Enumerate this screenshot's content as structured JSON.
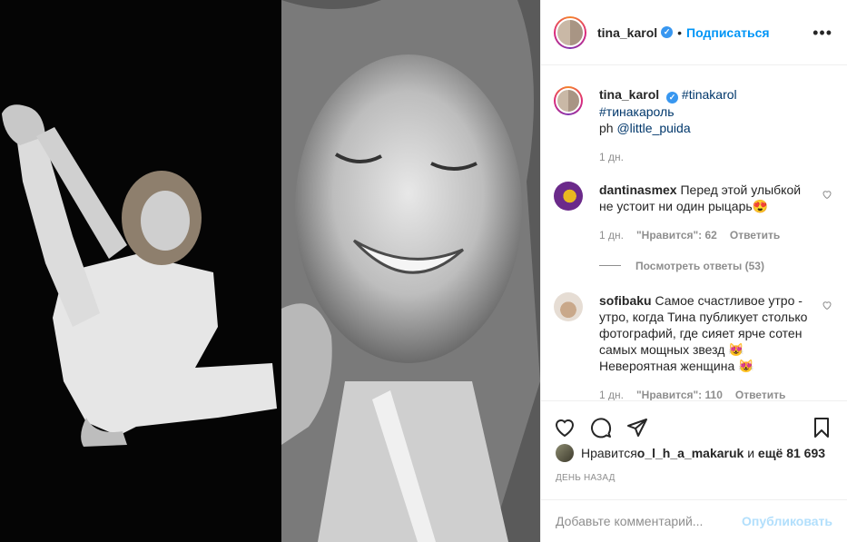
{
  "post": {
    "username": "tina_karol",
    "follow_label": "Подписаться",
    "separator": "•",
    "more_icon": "more-horizontal-icon",
    "caption": {
      "username": "tina_karol",
      "hashtag1": "#tinakarol",
      "hashtag2": "#тинакароль",
      "ph_prefix": "ph ",
      "mention": "@little_puida",
      "time": "1 дн."
    },
    "comments": [
      {
        "username": "dantinasmex",
        "text": "Перед этой улыбкой не устоит ни один рыцарь😍",
        "time": "1 дн.",
        "likes": "\"Нравится\": 62",
        "reply": "Ответить"
      },
      {
        "username": "sofibaku",
        "text": "Самое счастливое утро - утро, когда Тина публикует столько фотографий, где сияет ярче сотен самых мощных звезд 😻 Невероятная женщина 😻",
        "time": "1 дн.",
        "likes": "\"Нравится\": 110",
        "reply": "Ответить"
      }
    ],
    "view_replies": "Посмотреть ответы (53)",
    "likes_prefix": "Нравится ",
    "likes_user": "o_l_h_a_makaruk",
    "likes_middle": " и ",
    "likes_count": "ещё 81 693",
    "timestamp": "День назад",
    "comment_placeholder": "Добавьте комментарий...",
    "post_button": "Опубликовать"
  },
  "colors": {
    "accent": "#0095f6",
    "verified": "#3897f0",
    "muted": "#8e8e8e",
    "post_disabled": "#b2dffc"
  }
}
